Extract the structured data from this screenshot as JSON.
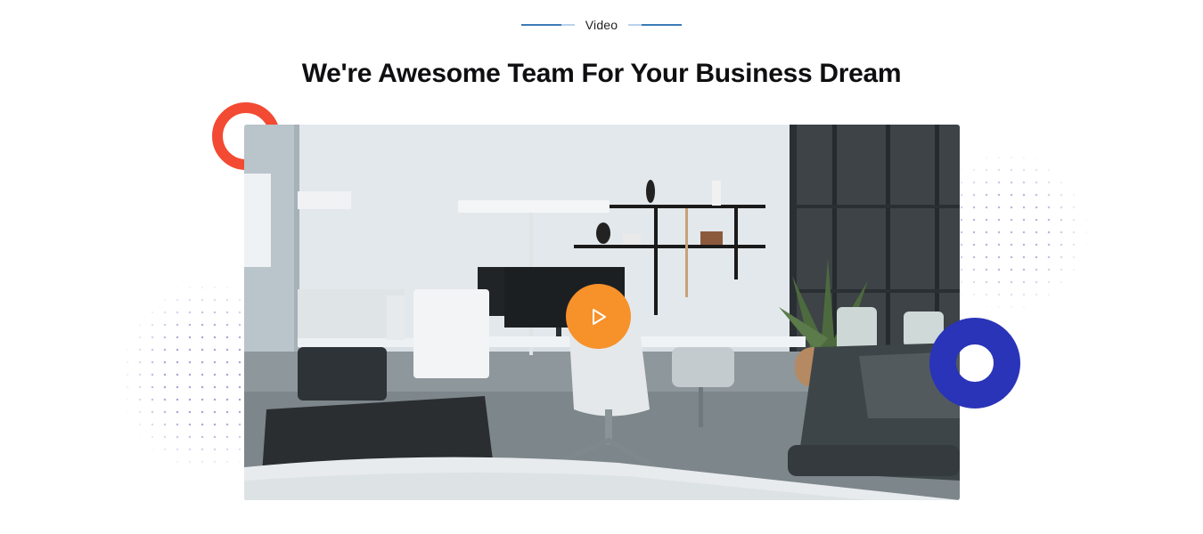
{
  "section": {
    "eyebrow": "Video",
    "title": "We're Awesome Team For Your Business Dream"
  },
  "video": {
    "thumbnail_icon": "office-scene-image",
    "play_icon": "play-icon"
  },
  "colors": {
    "accent_orange": "#f7912a",
    "ring_orange": "#f34a33",
    "ring_blue": "#2a34b8",
    "eyebrow_line": "#3b7bb8",
    "title": "#0f0f12"
  }
}
